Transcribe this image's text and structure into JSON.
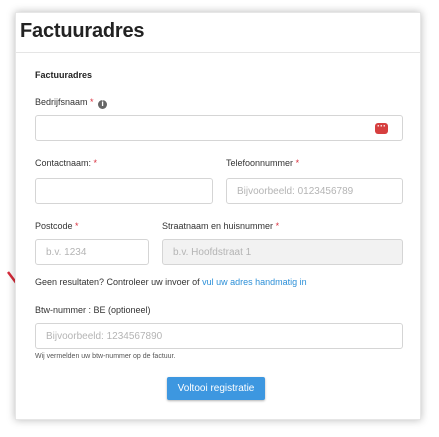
{
  "header": {
    "title": "Factuuradres"
  },
  "section": {
    "title": "Factuuradres"
  },
  "fields": {
    "company": {
      "label": "Bedrijfsnaam",
      "required": "*",
      "info": "i",
      "value": "",
      "placeholder": ""
    },
    "contact": {
      "label": "Contactnaam:",
      "required": "*",
      "value": "",
      "placeholder": ""
    },
    "phone": {
      "label": "Telefoonnummer",
      "required": "*",
      "placeholder": "Bijvoorbeeld: 0123456789"
    },
    "postcode": {
      "label": "Postcode",
      "required": "*",
      "placeholder": "b.v. 1234"
    },
    "street": {
      "label": "Straatnaam en huisnummer",
      "required": "*",
      "placeholder": "b.v. Hoofdstraat 1"
    },
    "vat": {
      "label": "Btw-nummer : BE (optioneel)",
      "placeholder": "Bijvoorbeeld: 1234567890",
      "hint": "Wij vermelden uw btw-nummer op de factuur."
    }
  },
  "no_results": {
    "text": "Geen resultaten? Controleer uw invoer of",
    "link": "vul uw adres handmatig in"
  },
  "submit": {
    "label": "Voltooi registratie"
  },
  "annotation": {
    "arrow_color": "#d62b3a"
  },
  "colors": {
    "accent": "#3d97e0",
    "required": "#d9303e",
    "link": "#2b8fd8"
  }
}
